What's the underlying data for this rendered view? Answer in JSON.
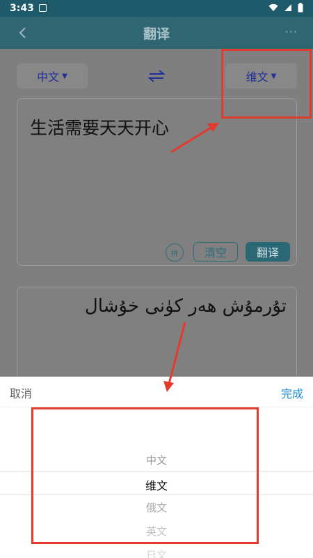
{
  "status_bar": {
    "time": "3:43"
  },
  "app_bar": {
    "title": "翻译",
    "more": "···"
  },
  "language_bar": {
    "source_lang": "中文",
    "target_lang": "维文"
  },
  "input_card": {
    "text": "生活需要天天开心",
    "pinyin_label": "拼",
    "clear_label": "清空",
    "translate_label": "翻译"
  },
  "output_card": {
    "text": "تۇرمۇش ھەر كۈنى خۇشال"
  },
  "picker": {
    "cancel_label": "取消",
    "done_label": "完成",
    "options": [
      "中文",
      "维文",
      "俄文",
      "英文",
      "日文"
    ],
    "selected": "维文"
  },
  "colors": {
    "accent": "#2a6876",
    "annotation": "#e43a2e",
    "done": "#1f8fd0"
  }
}
